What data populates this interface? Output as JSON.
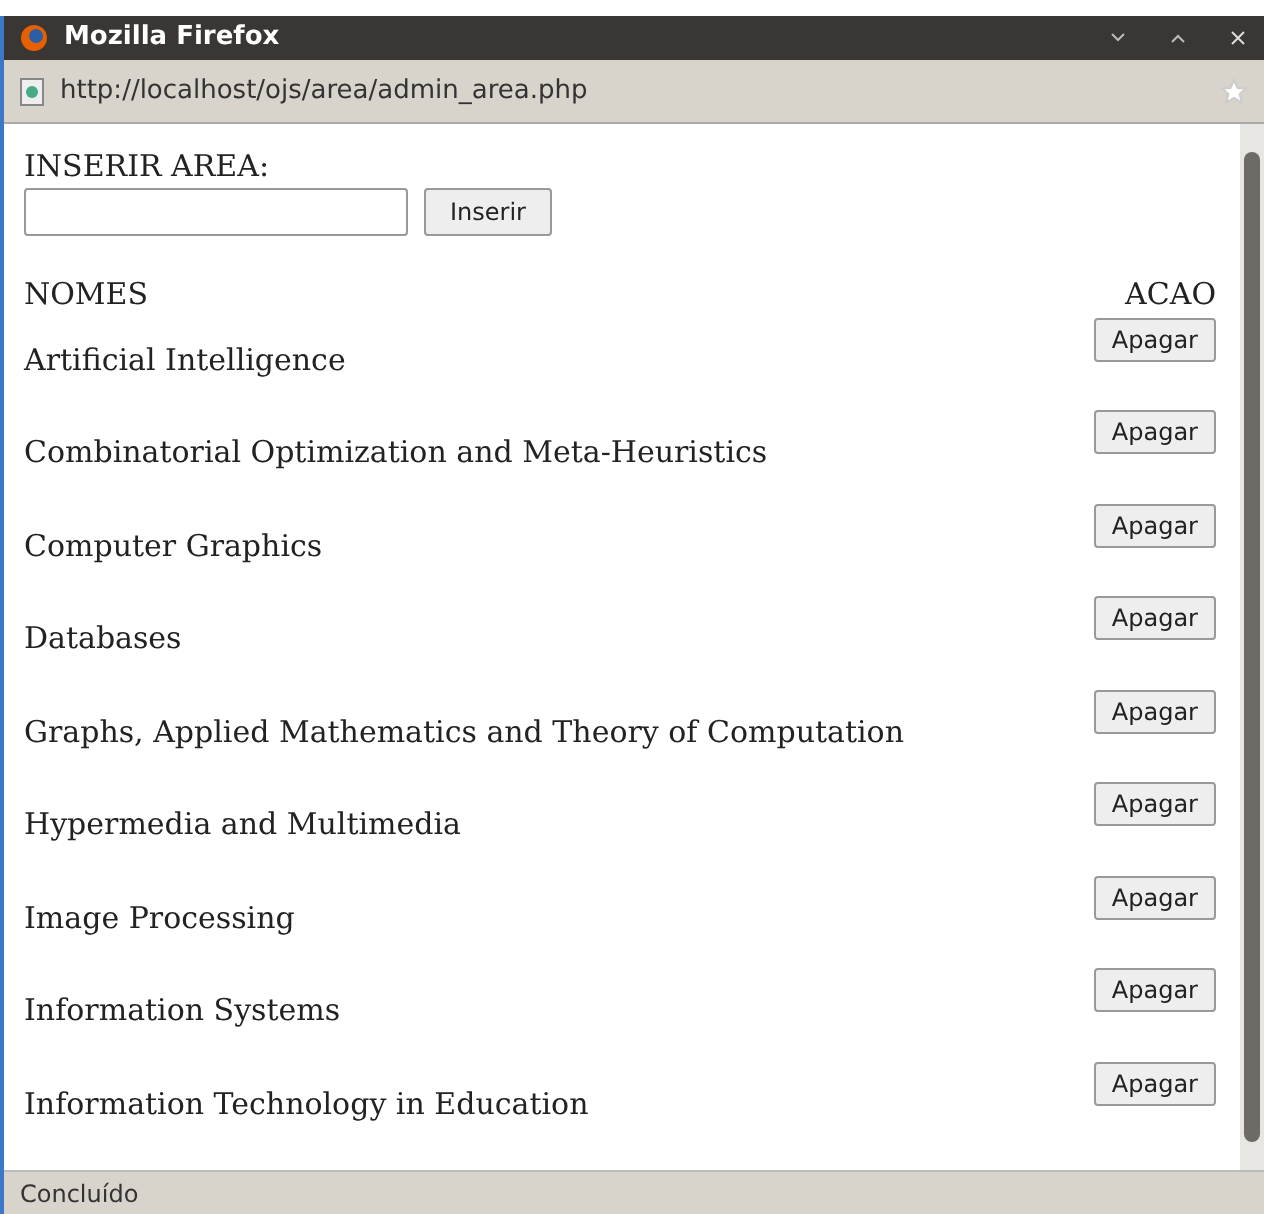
{
  "window": {
    "title": "Mozilla Firefox"
  },
  "address_bar": {
    "url": "http://localhost/ojs/area/admin_area.php"
  },
  "form": {
    "label": "INSERIR AREA:",
    "button": "Inserir"
  },
  "table": {
    "columns": [
      "NOMES",
      "ACAO"
    ],
    "rows": [
      {
        "name": "Artificial Intelligence",
        "action": "Apagar"
      },
      {
        "name": "Combinatorial Optimization and Meta-Heuristics",
        "action": "Apagar"
      },
      {
        "name": "Computer Graphics",
        "action": "Apagar"
      },
      {
        "name": "Databases",
        "action": "Apagar"
      },
      {
        "name": "Graphs, Applied Mathematics and Theory of Computation",
        "action": "Apagar"
      },
      {
        "name": "Hypermedia and Multimedia",
        "action": "Apagar"
      },
      {
        "name": "Image Processing",
        "action": "Apagar"
      },
      {
        "name": "Information Systems",
        "action": "Apagar"
      },
      {
        "name": "Information Technology in Education",
        "action": "Apagar"
      }
    ]
  },
  "status_bar": {
    "text": "Concluído"
  }
}
